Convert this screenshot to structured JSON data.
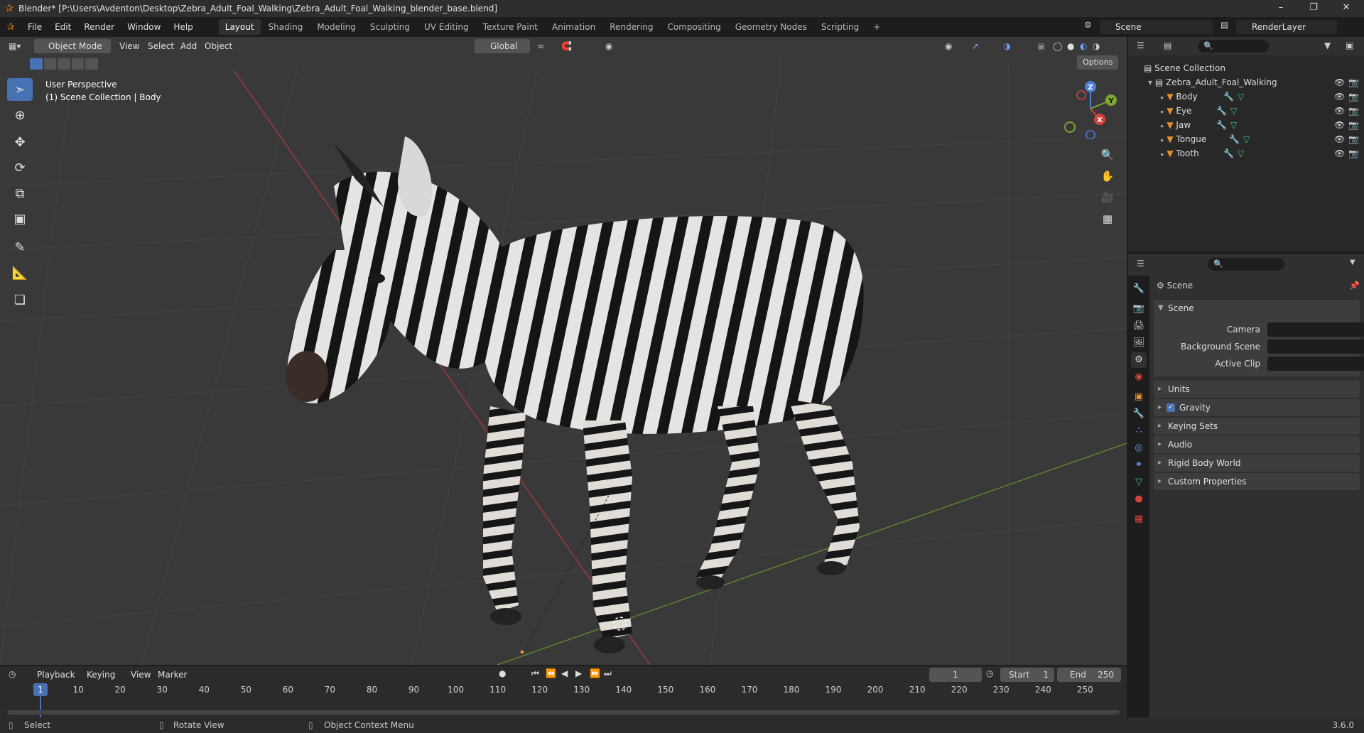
{
  "title_bar": {
    "title": "Blender* [P:\\Users\\Avdenton\\Desktop\\Zebra_Adult_Foal_Walking\\Zebra_Adult_Foal_Walking_blender_base.blend]",
    "minimize": "–",
    "maximize": "❐",
    "close": "✕"
  },
  "menu": {
    "items": [
      "File",
      "Edit",
      "Render",
      "Window",
      "Help"
    ],
    "workspaces": [
      "Layout",
      "Shading",
      "Modeling",
      "Sculpting",
      "UV Editing",
      "Texture Paint",
      "Animation",
      "Rendering",
      "Compositing",
      "Geometry Nodes",
      "Scripting"
    ],
    "active_workspace": "Layout",
    "add_workspace": "+",
    "scene": "Scene",
    "render_layer": "RenderLayer"
  },
  "viewport": {
    "mode": "Object Mode",
    "menus": [
      "View",
      "Select",
      "Add",
      "Object"
    ],
    "orientation": "Global",
    "options": "Options",
    "overlay_line1": "User Perspective",
    "overlay_line2": "(1) Scene Collection | Body",
    "gizmo": {
      "z": "Z",
      "y": "Y",
      "x": "X"
    }
  },
  "outliner": {
    "scene_collection": "Scene Collection",
    "collection": "Zebra_Adult_Foal_Walking",
    "objects": [
      "Body",
      "Eye",
      "Jaw",
      "Tongue",
      "Tooth"
    ]
  },
  "properties": {
    "header": "Scene",
    "section": "Scene",
    "fields": [
      {
        "label": "Camera"
      },
      {
        "label": "Background Scene"
      },
      {
        "label": "Active Clip"
      }
    ],
    "panels": [
      "Units",
      "Gravity",
      "Keying Sets",
      "Audio",
      "Rigid Body World",
      "Custom Properties"
    ],
    "gravity_checked": true
  },
  "timeline": {
    "menus": [
      "Playback",
      "Keying",
      "View",
      "Marker"
    ],
    "current_frame": "1",
    "start_label": "Start",
    "start": "1",
    "end_label": "End",
    "end": "250",
    "ticks": [
      "1",
      "10",
      "20",
      "30",
      "40",
      "50",
      "60",
      "70",
      "80",
      "90",
      "100",
      "110",
      "120",
      "130",
      "140",
      "150",
      "160",
      "170",
      "180",
      "190",
      "200",
      "210",
      "220",
      "230",
      "240",
      "250"
    ]
  },
  "status": {
    "select": "Select",
    "rotate": "Rotate View",
    "context": "Object Context Menu",
    "version": "3.6.0"
  },
  "colors": {
    "accent": "#4772b3",
    "x_axis": "#d9413d",
    "y_axis": "#7aa631",
    "z_axis": "#4c7fd6",
    "object_orange": "#e8902c",
    "mesh_green": "#3dbf8d"
  }
}
